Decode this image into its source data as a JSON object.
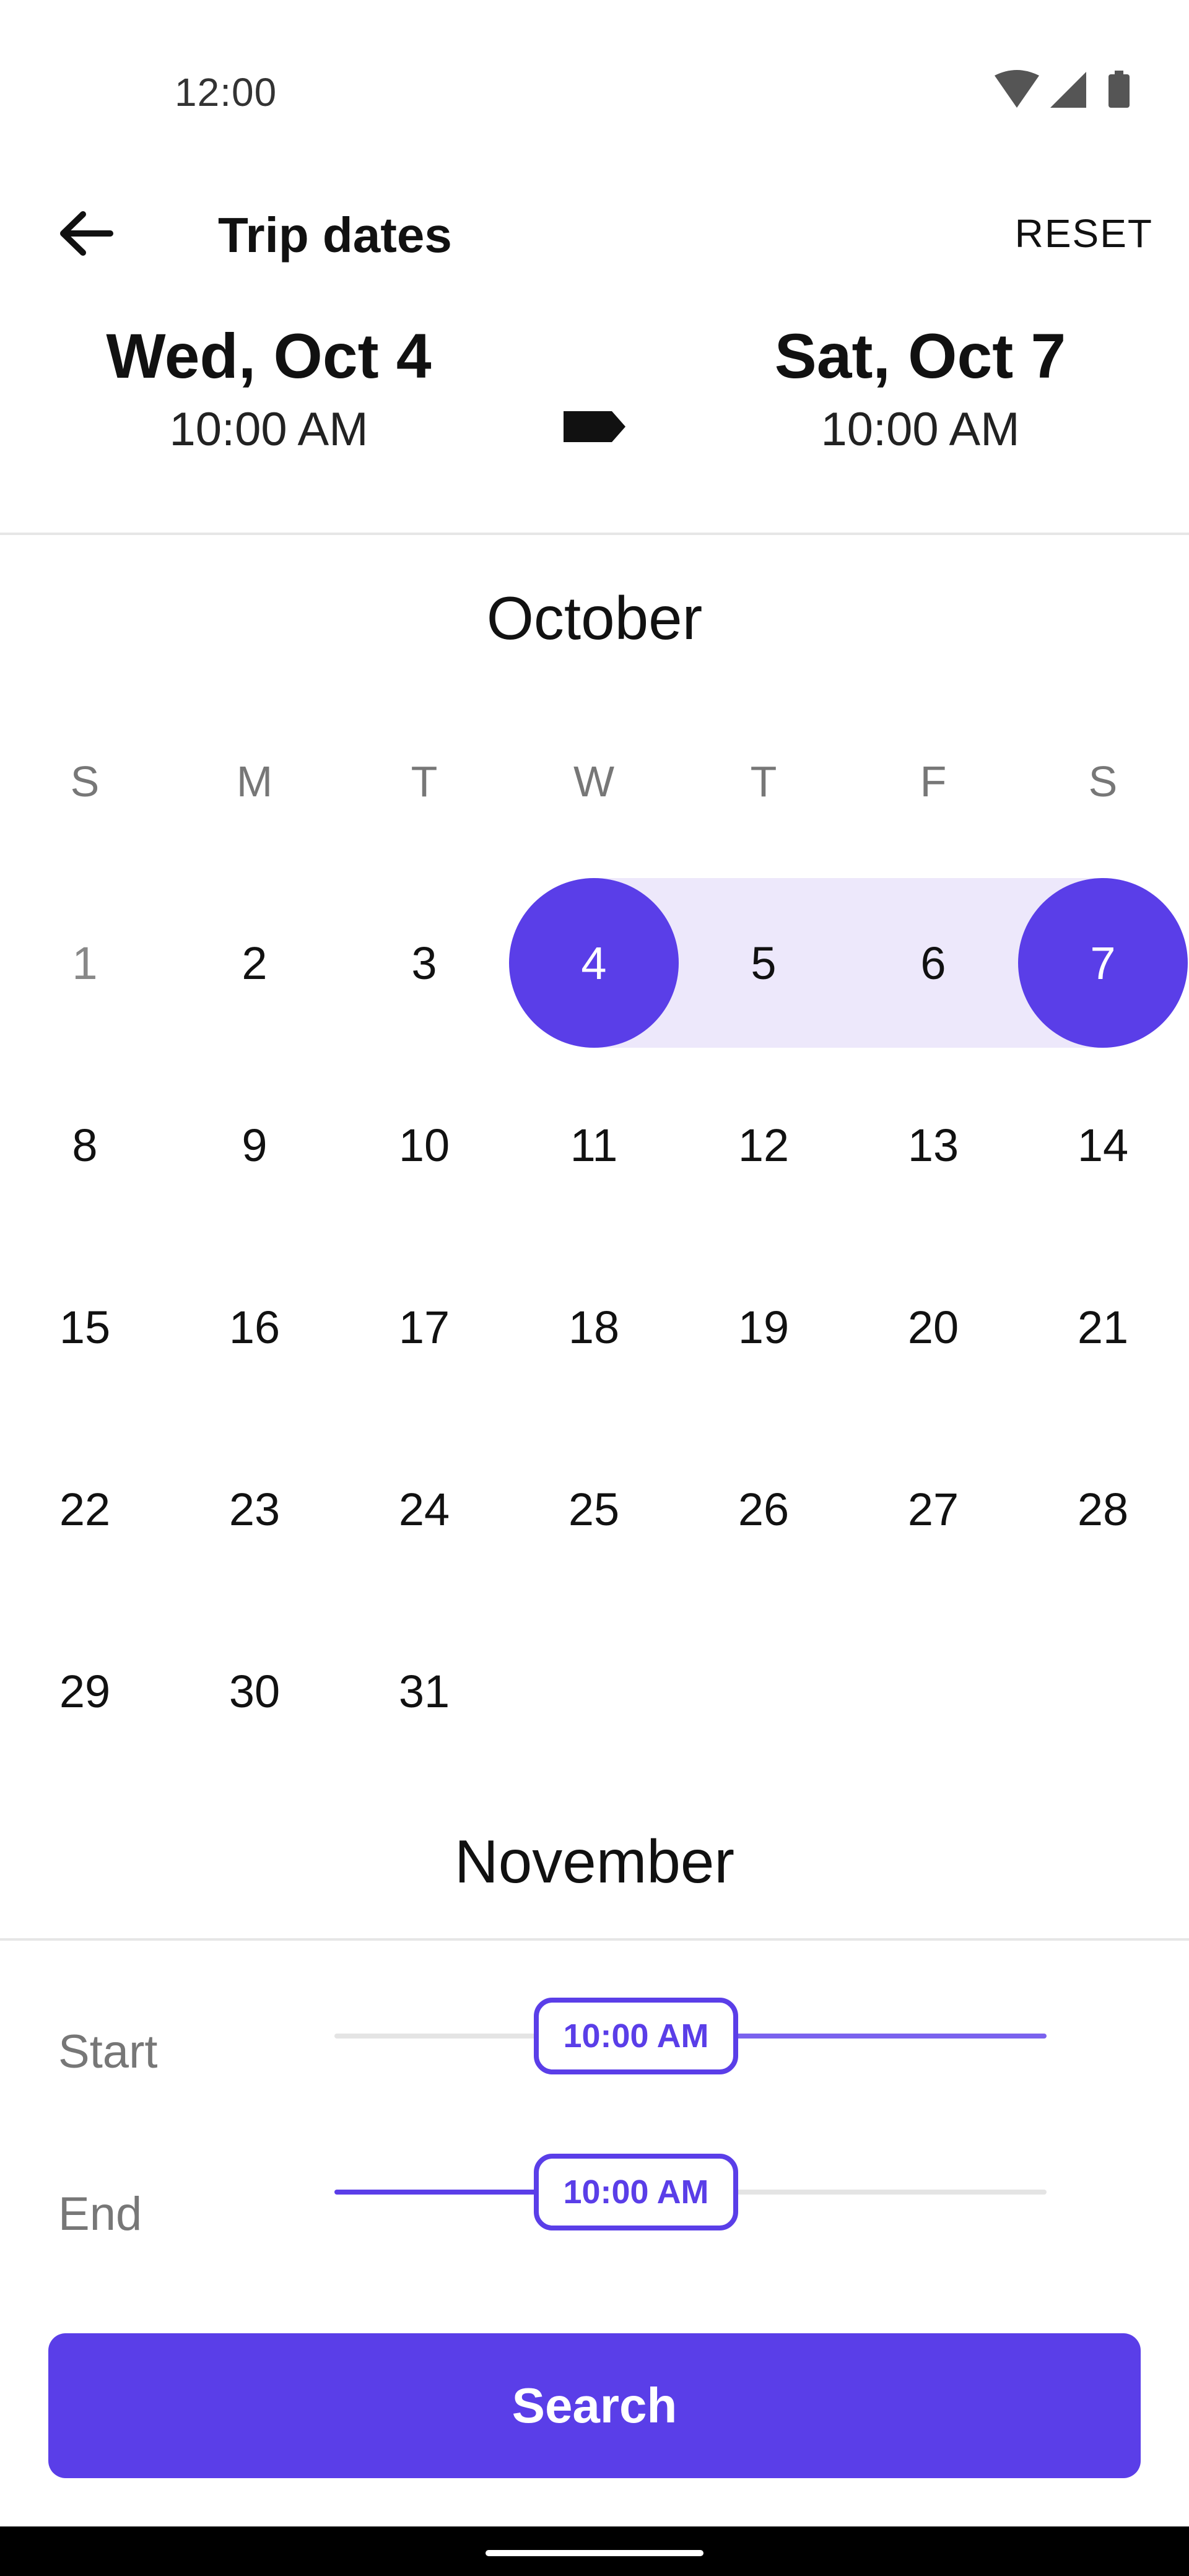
{
  "status_bar": {
    "time": "12:00"
  },
  "header": {
    "title": "Trip dates",
    "reset_label": "RESET"
  },
  "summary": {
    "start": {
      "date": "Wed, Oct 4",
      "time": "10:00 AM"
    },
    "end": {
      "date": "Sat, Oct 7",
      "time": "10:00 AM"
    }
  },
  "calendar": {
    "month": "October",
    "next_month": "November",
    "weekdays": [
      "S",
      "M",
      "T",
      "W",
      "T",
      "F",
      "S"
    ],
    "weeks": [
      [
        "1",
        "2",
        "3",
        "4",
        "5",
        "6",
        "7"
      ],
      [
        "8",
        "9",
        "10",
        "11",
        "12",
        "13",
        "14"
      ],
      [
        "15",
        "16",
        "17",
        "18",
        "19",
        "20",
        "21"
      ],
      [
        "22",
        "23",
        "24",
        "25",
        "26",
        "27",
        "28"
      ],
      [
        "29",
        "30",
        "31"
      ]
    ],
    "selected_start": "4",
    "selected_end": "7"
  },
  "time_panel": {
    "start_label": "Start",
    "end_label": "End",
    "start_value": "10:00 AM",
    "end_value": "10:00 AM"
  },
  "search_label": "Search",
  "colors": {
    "accent": "#5a3ee8",
    "range": "#ede8fb"
  }
}
